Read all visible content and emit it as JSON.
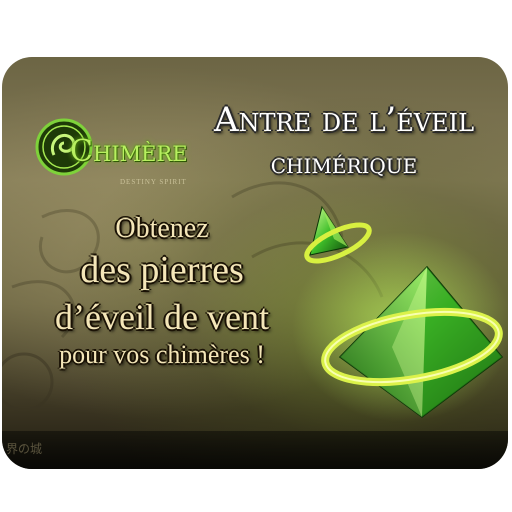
{
  "logo": {
    "word": "Chimère",
    "subtitle": "DESTINY SPIRIT"
  },
  "title": {
    "line1": "Antre de l’éveil",
    "line2": "chimérique"
  },
  "body": {
    "line1": "Obtenez",
    "line2": "des pierres",
    "line3": "d’éveil de vent",
    "line4": "pour vos chimères !"
  },
  "footer": {
    "corner_text": "界の城"
  },
  "colors": {
    "accent_green": "#b8f060",
    "crystal_green": "#3fbf2a",
    "ring_yellow": "#d8f040"
  }
}
